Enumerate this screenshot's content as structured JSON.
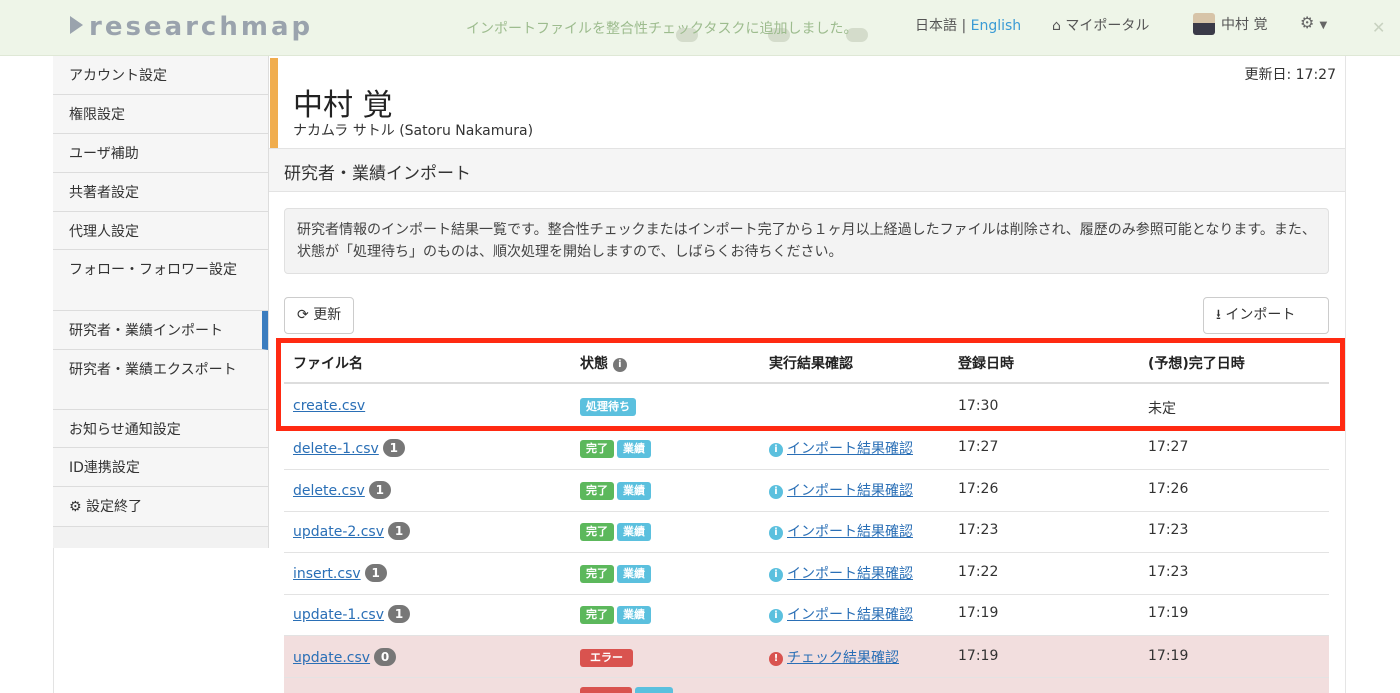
{
  "header": {
    "logo": "researchmap",
    "flash_message": "インポートファイルを整合性チェックタスクに追加しました。",
    "lang_ja": "日本語",
    "lang_sep": " | ",
    "lang_en": "English",
    "my_portal": "マイポータル",
    "user_name": "中村 覚"
  },
  "sidebar": {
    "items": [
      {
        "label": "アカウント設定"
      },
      {
        "label": "権限設定"
      },
      {
        "label": "ユーザ補助"
      },
      {
        "label": "共著者設定"
      },
      {
        "label": "代理人設定"
      },
      {
        "label": "フォロー・フォロワー設定"
      },
      {
        "label": "研究者・業績インポート"
      },
      {
        "label": "研究者・業績エクスポート"
      },
      {
        "label": "お知らせ通知設定"
      },
      {
        "label": "ID連携設定"
      },
      {
        "label": "設定終了"
      }
    ]
  },
  "profile": {
    "updated": "更新日: 17:27",
    "name": "中村 覚",
    "kana": "ナカムラ サトル  (Satoru Nakamura)"
  },
  "section": {
    "title": "研究者・業績インポート",
    "info": "研究者情報のインポート結果一覧です。整合性チェックまたはインポート完了から１ヶ月以上経過したファイルは削除され、履歴のみ参照可能となります。また、状態が「処理待ち」のものは、順次処理を開始しますので、しばらくお待ちください。",
    "refresh_button": "更新",
    "import_button": "インポート"
  },
  "table": {
    "headers": [
      "ファイル名",
      "状態",
      "実行結果確認",
      "登録日時",
      "(予想)完了日時"
    ],
    "rows": [
      {
        "file": "create.csv",
        "count": "",
        "status": [
          "処理待ち"
        ],
        "result": "",
        "registered": "17:30",
        "completed": "未定"
      },
      {
        "file": "delete-1.csv",
        "count": "1",
        "status": [
          "完了",
          "業績"
        ],
        "result": "インポート結果確認",
        "registered": "17:27",
        "completed": "17:27"
      },
      {
        "file": "delete.csv",
        "count": "1",
        "status": [
          "完了",
          "業績"
        ],
        "result": "インポート結果確認",
        "registered": "17:26",
        "completed": "17:26"
      },
      {
        "file": "update-2.csv",
        "count": "1",
        "status": [
          "完了",
          "業績"
        ],
        "result": "インポート結果確認",
        "registered": "17:23",
        "completed": "17:23"
      },
      {
        "file": "insert.csv",
        "count": "1",
        "status": [
          "完了",
          "業績"
        ],
        "result": "インポート結果確認",
        "registered": "17:22",
        "completed": "17:23"
      },
      {
        "file": "update-1.csv",
        "count": "1",
        "status": [
          "完了",
          "業績"
        ],
        "result": "インポート結果確認",
        "registered": "17:19",
        "completed": "17:19"
      },
      {
        "file": "update.csv",
        "count": "0",
        "status": [
          "エラー"
        ],
        "result": "チェック結果確認",
        "registered": "17:19",
        "completed": "17:19"
      }
    ]
  },
  "colors": {
    "accent": "#f0ad4e",
    "highlight": "#ff2a12",
    "link": "#2a6fb6",
    "success": "#5cb85c",
    "info": "#5bc0de",
    "danger": "#d9534f"
  }
}
